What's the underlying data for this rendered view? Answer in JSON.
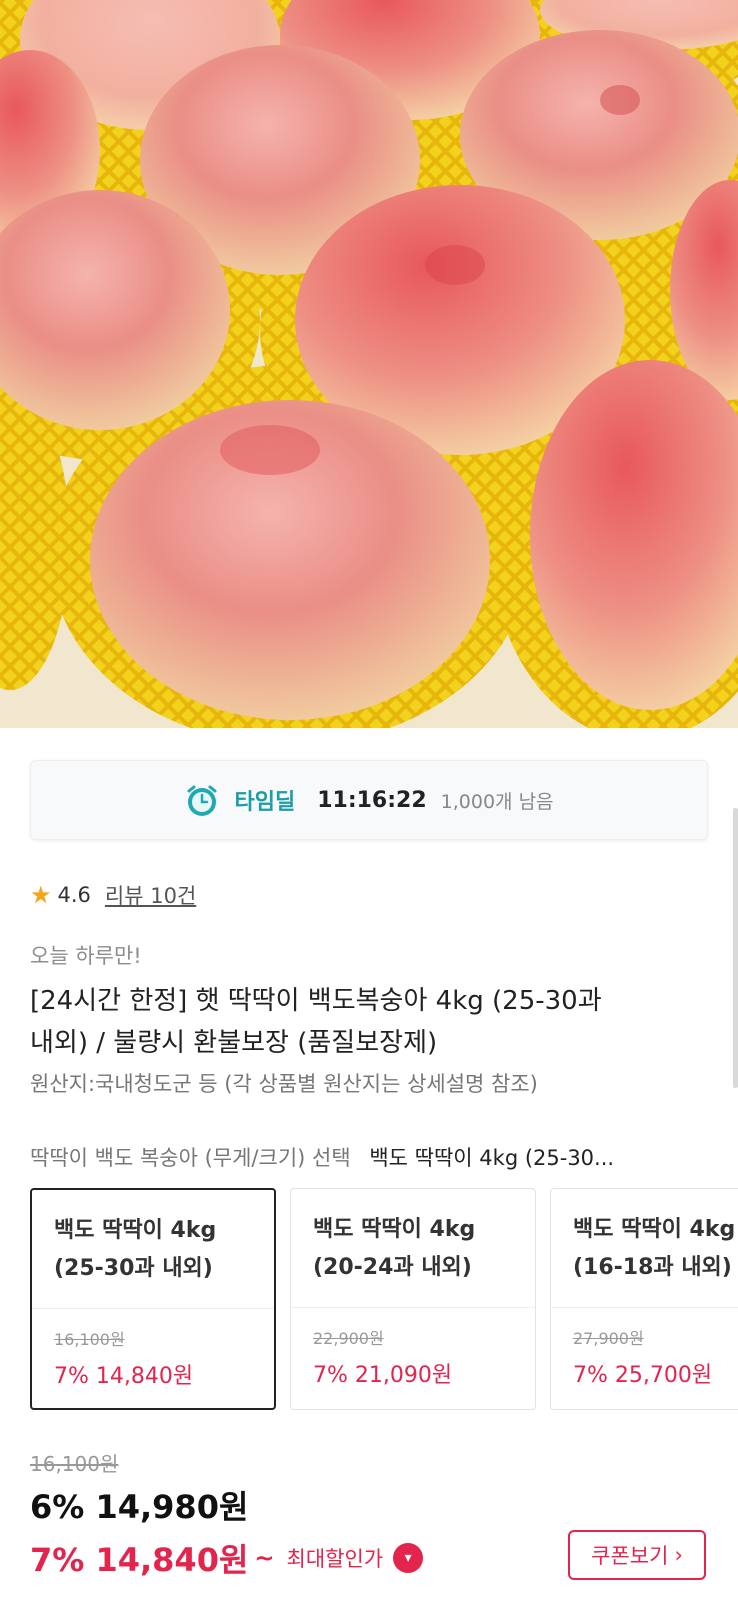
{
  "hero": {
    "image": "peaches-in-yellow-foam-nets"
  },
  "timedeal": {
    "icon": "alarm-clock-icon",
    "label": "타임딜",
    "time": "11:16:22",
    "remaining": "1,000개 남음"
  },
  "rating": {
    "score": "4.6",
    "review_link": "리뷰 10건"
  },
  "product": {
    "promo": "오늘 하루만!",
    "title_line1": "[24시간 한정] 햇 딱딱이 백도복숭아 4kg (25-30과",
    "title_line2": "내외) / 불량시 환불보장 (품질보장제)",
    "origin": "원산지:국내청도군 등 (각 상품별 원산지는 상세설명 참조)"
  },
  "option": {
    "label": "딱딱이 백도 복숭아 (무게/크기) 선택",
    "selected_value": "백도 딱딱이 4kg (25-30...",
    "cards": [
      {
        "name": "백도 딱딱이 4kg\n(25-30과 내외)",
        "original_price": "16,100원",
        "discount_price": "7% 14,840원",
        "selected": true
      },
      {
        "name": "백도 딱딱이 4kg\n(20-24과 내외)",
        "original_price": "22,900원",
        "discount_price": "7% 21,090원",
        "selected": false
      },
      {
        "name": "백도 딱딱이 4kg\n(16-18과 내외)",
        "original_price": "27,900원",
        "discount_price": "7% 25,700원",
        "selected": false
      }
    ]
  },
  "price": {
    "original": "16,100원",
    "current": "6% 14,980원",
    "max_discount": "7% 14,840원",
    "tilde": "~",
    "max_label": "최대할인가"
  },
  "coupon_button": {
    "label": "쿠폰보기",
    "icon": "chevron-right-icon"
  },
  "colors": {
    "accent": "#e3244c",
    "timedeal": "#1a9ea8",
    "star": "#f3a61c"
  }
}
